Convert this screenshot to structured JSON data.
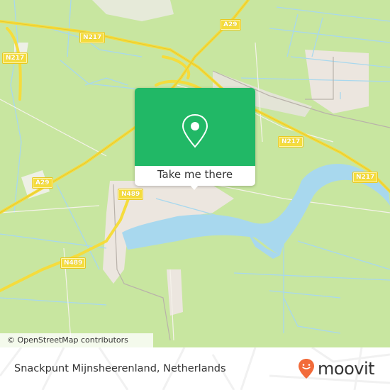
{
  "map": {
    "colors": {
      "land": "#c8e6a0",
      "water": "#a8d8ee",
      "urban": "#ece6df",
      "highway": "#f5dc3c",
      "popup": "#21b866",
      "brand": "#f26b3a"
    },
    "road_labels": [
      {
        "id": "n217-west",
        "text": "N217"
      },
      {
        "id": "n217-north",
        "text": "N217"
      },
      {
        "id": "a29-north",
        "text": "A29"
      },
      {
        "id": "a29-west",
        "text": "A29"
      },
      {
        "id": "n489-town",
        "text": "N489"
      },
      {
        "id": "n489-south",
        "text": "N489"
      },
      {
        "id": "n217-east",
        "text": "N217"
      },
      {
        "id": "n217-far-east",
        "text": "N217"
      }
    ],
    "attribution": "© OpenStreetMap contributors"
  },
  "popup": {
    "icon": "map-pin-icon",
    "button_label": "Take me there"
  },
  "footer": {
    "place_name": "Snackpunt Mijnsheerenland, Netherlands",
    "logo_text": "moovit",
    "logo_icon": "moovit-smile-pin-icon"
  }
}
